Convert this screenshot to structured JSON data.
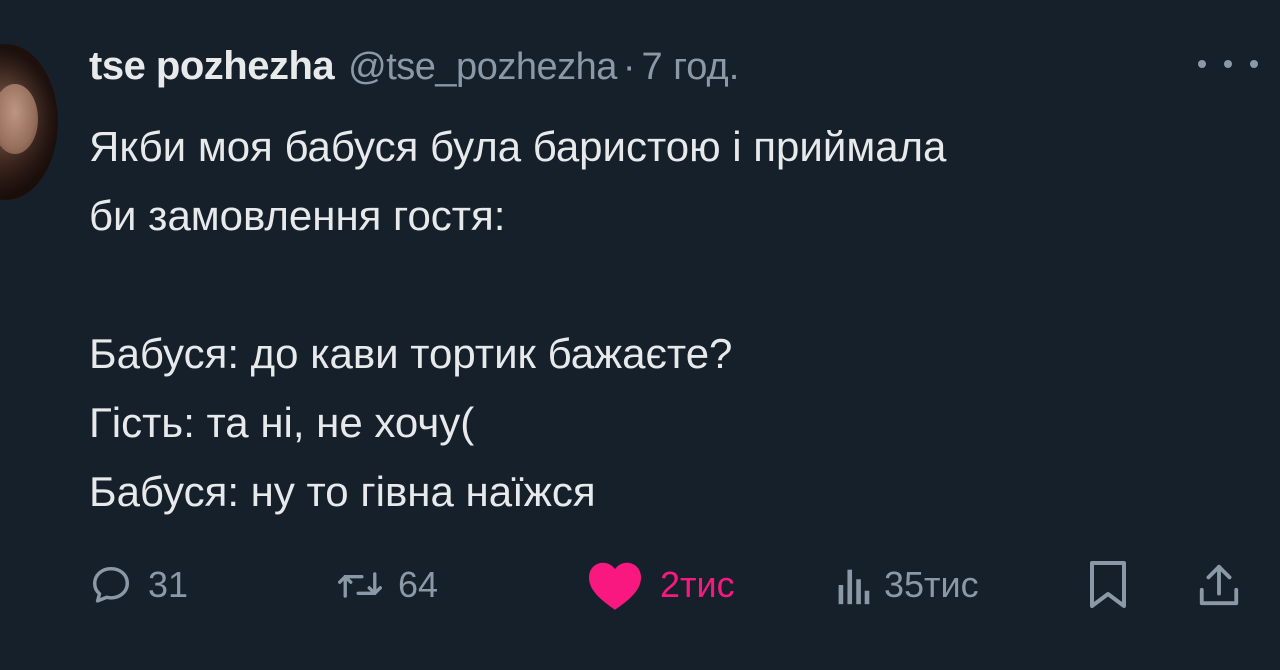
{
  "tweet": {
    "author_name": "tse pozhezha",
    "handle": "@tse_pozhezha",
    "separator": "·",
    "time": "7 год.",
    "lines": [
      "Якби моя бабуся була баристою і приймала",
      "би замовлення гостя:",
      "",
      "Бабуся: до кави тортик бажаєте?",
      "Гість: та ні, не хочу(",
      "Бабуся: ну то гівна наїжся"
    ]
  },
  "actions": {
    "reply_count": "31",
    "retweet_count": "64",
    "like_count": "2тис",
    "views_count": "35тис"
  },
  "icons": {
    "reply": "reply-icon",
    "retweet": "retweet-icon",
    "like": "heart-filled-icon",
    "views": "views-icon",
    "bookmark": "bookmark-icon",
    "share": "share-icon",
    "more": "more-dots-icon"
  },
  "colors": {
    "background": "#15202b",
    "text": "#e7e9ea",
    "muted": "#8b98a5",
    "like": "#f91880"
  }
}
